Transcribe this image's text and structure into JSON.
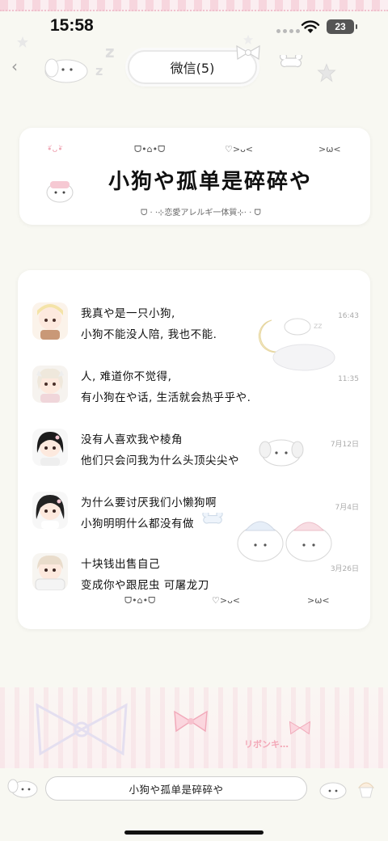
{
  "status_bar": {
    "time": "15:58",
    "battery": "23"
  },
  "nav": {
    "title": "微信(5)"
  },
  "header_card": {
    "kaomoji": [
      "•᷄ᴗ•᷅",
      "ᗜ•⌂•ᗜ",
      "♡>ᴗ<",
      ">ω<"
    ],
    "title": "小狗や孤单是碎碎や",
    "subtitle": "ᗜ · ·⊹恋愛アレルギ一体質⊹· · ᗜ"
  },
  "chats": [
    {
      "line1": "我真や是一只小狗,",
      "line2": "小狗不能没人陪, 我也不能.",
      "time": "16:43"
    },
    {
      "line1": "人, 难道你不觉得,",
      "line2": "有小狗在や话, 生活就会热乎乎や.",
      "time": "11:35"
    },
    {
      "line1": "没有人喜欢我や棱角",
      "line2": "他们只会问我为什么头顶尖尖や",
      "time": "7月12日"
    },
    {
      "line1": "为什么要讨厌我们小懒狗啊",
      "line2": "小狗明明什么都没有做",
      "time": "7月4日"
    },
    {
      "line1": "十块钱出售自己",
      "line2": "变成你や跟屁虫 可屠龙刀",
      "time": "3月26日"
    }
  ],
  "list_footer_kaomoji": [
    "ᗜ•⌂•ᗜ",
    "♡>ᴗ<",
    ">ω<"
  ],
  "ribbon_text": "リボンキ…",
  "bottom_bar": {
    "input_text": "小狗や孤单是碎碎や"
  },
  "colors": {
    "background": "#f8f8f2",
    "accent_pink": "#f7d6de",
    "card": "#ffffff"
  }
}
